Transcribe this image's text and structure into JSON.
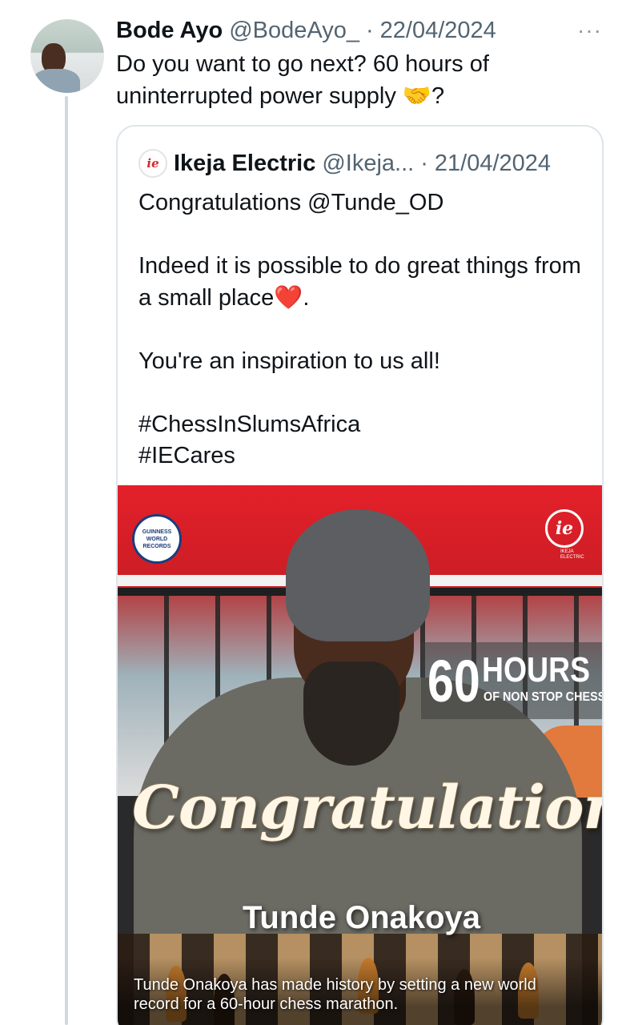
{
  "tweet": {
    "author_name": "Bode Ayo",
    "author_handle": "@BodeAyo_",
    "separator": "·",
    "date": "22/04/2024",
    "more_label": "···",
    "text_before_emoji": "Do you want to go next? 60 hours of uninterrupted power supply ",
    "emoji": "🤝",
    "text_after_emoji": "?"
  },
  "quote": {
    "author_name": "Ikeja Electric",
    "author_handle": "@Ikeja...",
    "separator": "·",
    "date": "21/04/2024",
    "logo_text": "ie",
    "lines": {
      "greeting": "Congratulations @Tunde_OD",
      "line2_text": "Indeed it is possible to do great things from a small place",
      "line2_emoji": "❤️",
      "line2_end": ".",
      "line3": "You're an inspiration to us all!",
      "hashtag1": "#ChessInSlumsAfrica",
      "hashtag2": "#IECares"
    }
  },
  "media": {
    "gwr_badge": "GUINNESS WORLD RECORDS",
    "ie_logo_mark": "ie",
    "ie_logo_sub": "IKEJA ELECTRIC",
    "hours_number": "60",
    "hours_word": "HOURS",
    "hours_sub": "OF NON STOP CHESS",
    "headline": "Congratulations",
    "winner": "Tunde Onakoya",
    "caption": "Tunde Onakoya has made history by setting a new world record for a 60-hour chess marathon.",
    "colors": {
      "brand_red": "#e3202a",
      "gwr_blue": "#1a3d7c"
    }
  }
}
